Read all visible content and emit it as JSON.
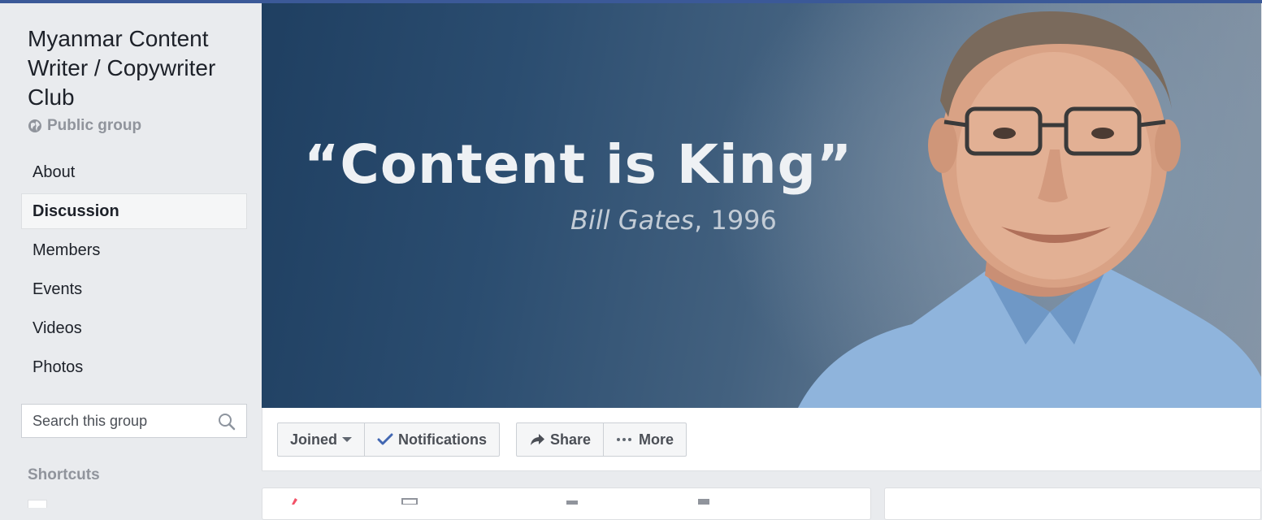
{
  "group": {
    "name": "Myanmar Content Writer / Copywriter Club",
    "privacy": "Public group"
  },
  "nav": {
    "items": [
      {
        "label": "About"
      },
      {
        "label": "Discussion"
      },
      {
        "label": "Members"
      },
      {
        "label": "Events"
      },
      {
        "label": "Videos"
      },
      {
        "label": "Photos"
      }
    ]
  },
  "search": {
    "placeholder": "Search this group"
  },
  "shortcuts": {
    "heading": "Shortcuts"
  },
  "cover": {
    "quote": "“Content is King”",
    "attribution_name": "Bill Gates",
    "attribution_year": ", 1996"
  },
  "actions": {
    "joined": "Joined",
    "notifications": "Notifications",
    "share": "Share",
    "more": "More"
  },
  "colors": {
    "brand_blue": "#3b5998",
    "check_blue": "#4267b2",
    "page_bg": "#e9ebee"
  }
}
